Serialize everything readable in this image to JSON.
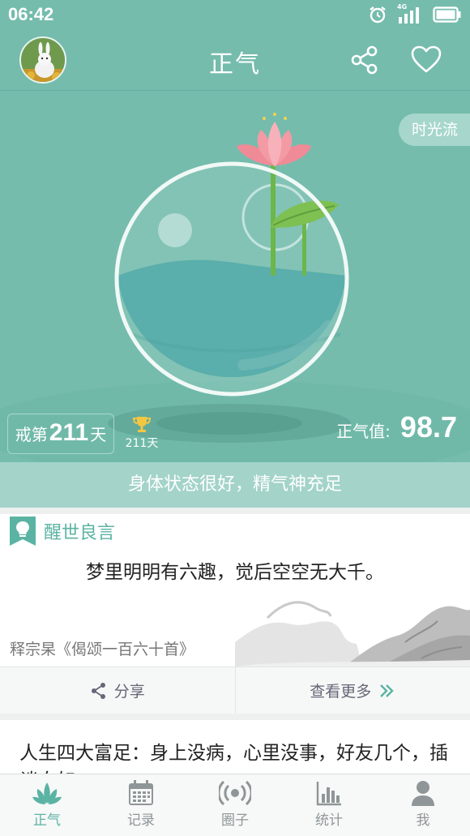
{
  "status_bar": {
    "time": "06:42",
    "network": "4G"
  },
  "header": {
    "title": "正气"
  },
  "hero": {
    "time_flow_label": "时光流",
    "streak_prefix": "戒第",
    "streak_days": "211",
    "streak_suffix": "天",
    "trophy_days": "211天",
    "qi_label": "正气值:",
    "qi_value": "98.7",
    "status_text": "身体状态很好，精气神充足"
  },
  "quote": {
    "section_title": "醒世良言",
    "text": "梦里明明有六趣，觉后空空无大千。",
    "source": "释宗杲《偈颂一百六十首》",
    "share_label": "分享",
    "more_label": "查看更多"
  },
  "article": {
    "text": "人生四大富足：身上没病，心里没事，好友几个，插谈自如"
  },
  "tabbar": {
    "items": [
      {
        "label": "正气",
        "icon": "lotus-icon",
        "active": true
      },
      {
        "label": "记录",
        "icon": "calendar-icon",
        "active": false
      },
      {
        "label": "圈子",
        "icon": "broadcast-icon",
        "active": false
      },
      {
        "label": "统计",
        "icon": "bar-chart-icon",
        "active": false
      },
      {
        "label": "我",
        "icon": "person-icon",
        "active": false
      }
    ]
  },
  "colors": {
    "primary": "#75bcad",
    "accent": "#5bb3a3",
    "water": "#5aaeab",
    "lotus": "#ee8a94"
  }
}
